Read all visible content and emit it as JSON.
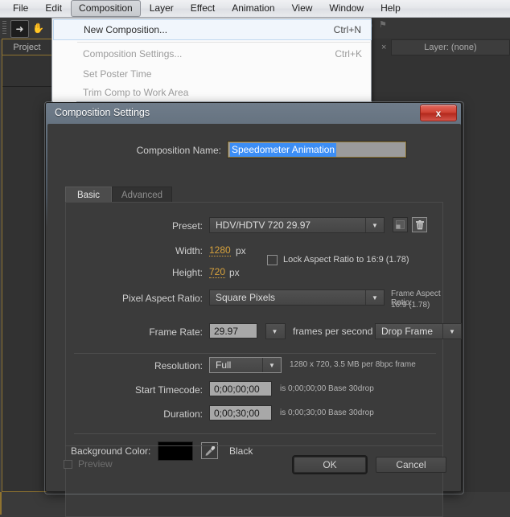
{
  "menubar": {
    "items": [
      {
        "label": "File",
        "active": false
      },
      {
        "label": "Edit",
        "active": false
      },
      {
        "label": "Composition",
        "active": true
      },
      {
        "label": "Layer",
        "active": false
      },
      {
        "label": "Effect",
        "active": false
      },
      {
        "label": "Animation",
        "active": false
      },
      {
        "label": "View",
        "active": false
      },
      {
        "label": "Window",
        "active": false
      },
      {
        "label": "Help",
        "active": false
      }
    ]
  },
  "panels": {
    "project_tab": "Project",
    "layer_tab": "Layer: (none)"
  },
  "composition_menu": {
    "items": [
      {
        "label": "New Composition...",
        "accel": "Ctrl+N",
        "highlighted": true,
        "disabled": false
      },
      {
        "label": "Composition Settings...",
        "accel": "Ctrl+K",
        "highlighted": false,
        "disabled": true
      },
      {
        "label": "Set Poster Time",
        "accel": "",
        "highlighted": false,
        "disabled": true
      },
      {
        "label": "Trim Comp to Work Area",
        "accel": "",
        "highlighted": false,
        "disabled": true
      }
    ]
  },
  "dialog": {
    "title": "Composition Settings",
    "close_label": "x",
    "name_label": "Composition Name:",
    "name_value": "Speedometer Animation",
    "tabs": [
      {
        "label": "Basic",
        "selected": true
      },
      {
        "label": "Advanced",
        "selected": false
      }
    ],
    "preset": {
      "label": "Preset:",
      "value": "HDV/HDTV 720 29.97",
      "save_icon": "save-preset-icon",
      "delete_icon": "trash-icon"
    },
    "width": {
      "label": "Width:",
      "value": "1280",
      "unit": "px"
    },
    "height": {
      "label": "Height:",
      "value": "720",
      "unit": "px"
    },
    "lock_aspect": {
      "label": "Lock Aspect Ratio to 16:9 (1.78)",
      "checked": false
    },
    "pixel_aspect": {
      "label": "Pixel Aspect Ratio:",
      "value": "Square Pixels"
    },
    "frame_aspect": {
      "label": "Frame Aspect Ratio:",
      "value": "16:9 (1.78)"
    },
    "frame_rate": {
      "label": "Frame Rate:",
      "value": "29.97",
      "unit": "frames per second",
      "drop": "Drop Frame"
    },
    "resolution": {
      "label": "Resolution:",
      "value": "Full",
      "note": "1280 x 720, 3.5 MB per 8bpc frame"
    },
    "start_timecode": {
      "label": "Start Timecode:",
      "value": "0;00;00;00",
      "note": "is 0;00;00;00  Base 30drop"
    },
    "duration": {
      "label": "Duration:",
      "value": "0;00;30;00",
      "note": "is 0;00;30;00  Base 30drop"
    },
    "background_color": {
      "label": "Background Color:",
      "swatch": "#000000",
      "name": "Black",
      "eyedropper_icon": "eyedropper-icon"
    },
    "preview": {
      "label": "Preview",
      "checked": false
    },
    "ok_label": "OK",
    "cancel_label": "Cancel"
  },
  "colors": {
    "accent_orange": "#d8a23c",
    "focus_gold": "#8a7231",
    "selection_blue": "#3c8ef5",
    "close_red": "#cf4335",
    "panel_bg": "#3b3b3b"
  }
}
